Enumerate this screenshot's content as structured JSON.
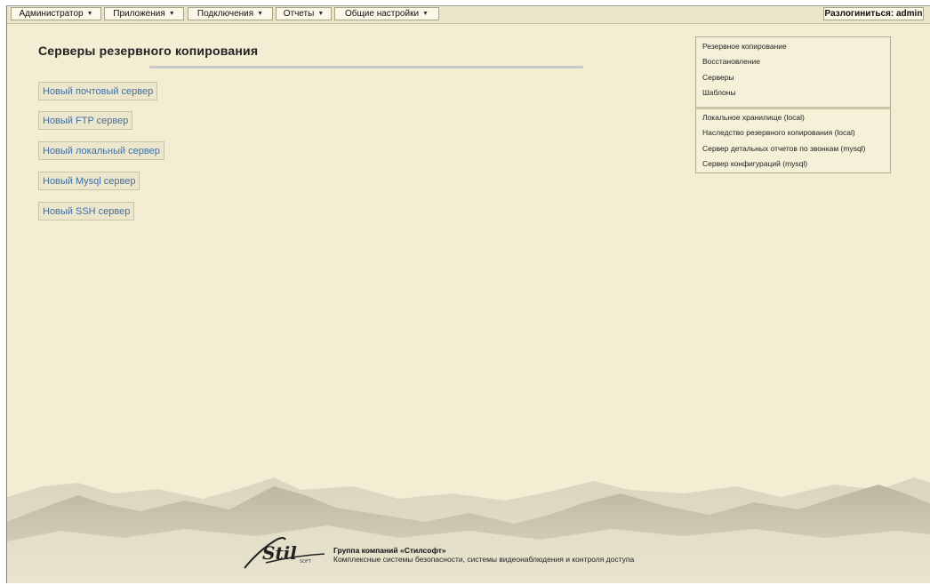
{
  "menu": {
    "admin": "Администратор",
    "apps": "Приложения",
    "connections": "Подключения",
    "reports": "Отчеты",
    "settings": "Общие настройки",
    "logout": "Разлогиниться: admin"
  },
  "icons": {
    "dropdown": "caret-down-icon"
  },
  "page": {
    "title": "Серверы резервного копирования"
  },
  "new_server_buttons": [
    "Новый почтовый сервер",
    "Новый FTP сервер",
    "Новый локальный сервер",
    "Новый Mysql сервер",
    "Новый SSH сервер"
  ],
  "side_menu": {
    "nav": [
      "Резервное копирование",
      "Восстановление",
      "Серверы",
      "Шаблоны"
    ],
    "servers": [
      "Локальное хранилище (local)",
      "Наследство резервного копирования (local)",
      "Сервер детальных отчетов по звонкам (mysql)",
      "Сервер конфигураций (mysql)"
    ]
  },
  "footer": {
    "company": "Группа компаний «Стилсофт»",
    "description": "Комплексные системы безопасности, системы видеонаблюдения и контроля доступа",
    "logo_text": "Stil",
    "logo_sub": "SOFT"
  },
  "colors": {
    "background": "#f3eed3",
    "link": "#3f70a4"
  }
}
